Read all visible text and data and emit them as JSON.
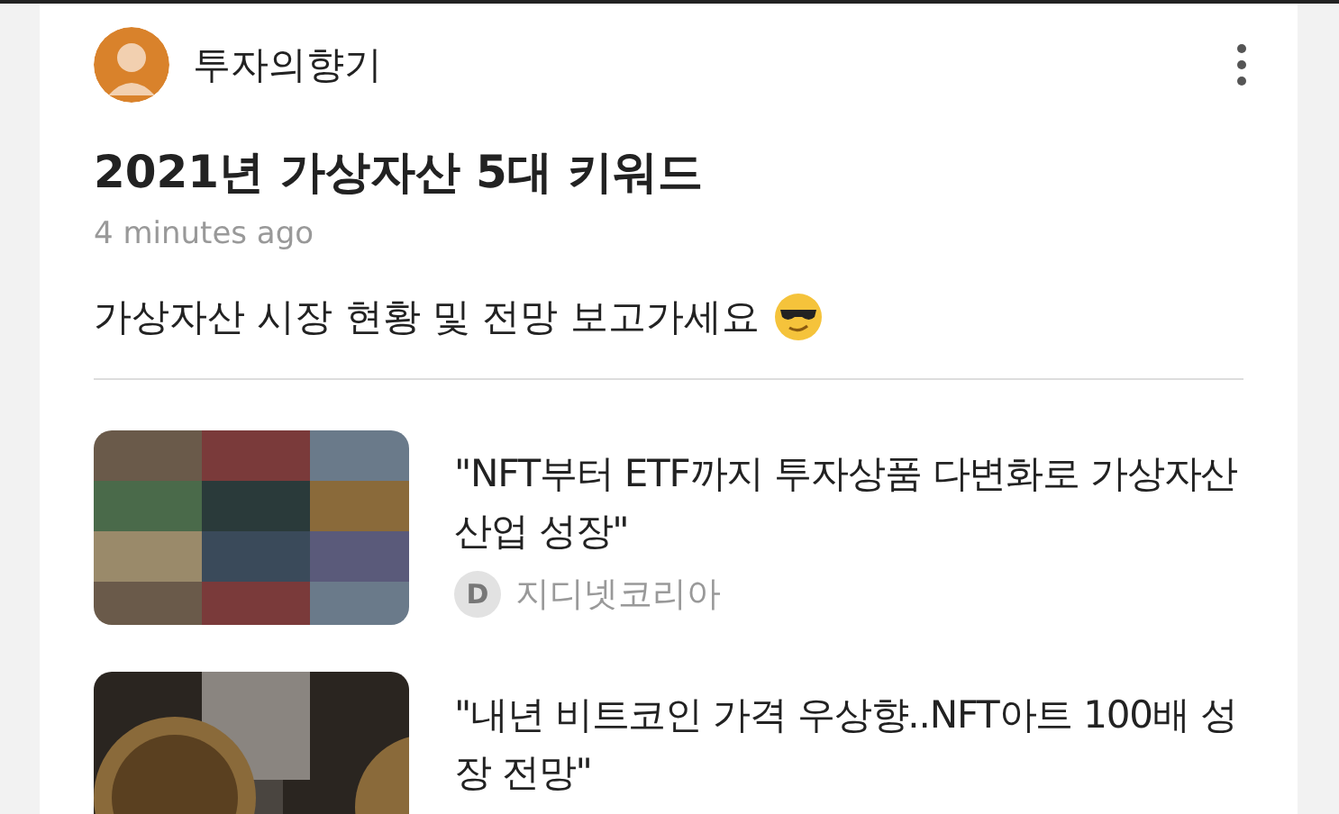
{
  "author": {
    "name": "투자의향기"
  },
  "post": {
    "title": "2021년 가상자산 5대 키워드",
    "time": "4 minutes ago",
    "body": "가상자산 시장 현황 및 전망 보고가세요"
  },
  "articles": [
    {
      "headline": "\"NFT부터 ETF까지 투자상품 다변화로 가상자산 산업 성장\"",
      "source": "지디넷코리아",
      "source_icon": "D"
    },
    {
      "headline": "\"내년 비트코인 가격 우상향..NFT아트 100배 성장 전망\""
    }
  ]
}
